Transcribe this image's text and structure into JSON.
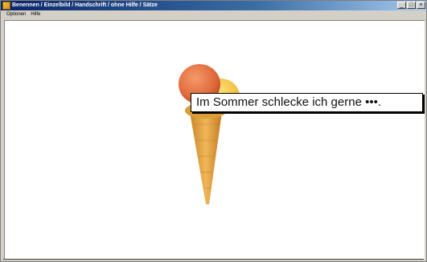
{
  "window": {
    "title": "Benennen / Einzelbild / Handschrift / ohne Hilfe / Sätze",
    "minimize": "_",
    "maximize": "□",
    "close": "×"
  },
  "menu": {
    "items": [
      {
        "label": "Optionen"
      },
      {
        "label": "Hilfe"
      }
    ]
  },
  "content": {
    "image_subject": "ice-cream-cone",
    "sentence": "Im Sommer schlecke ich gerne •••."
  },
  "colors": {
    "titlebar_start": "#0a246a",
    "titlebar_end": "#a6caf0",
    "scoop_strawberry": "#e0683a",
    "scoop_vanilla": "#f0c040",
    "cone": "#e8a94a"
  }
}
